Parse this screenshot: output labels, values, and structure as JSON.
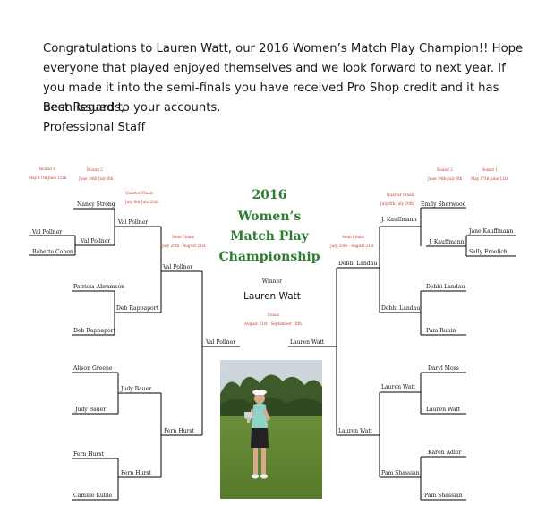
{
  "intro": {
    "paragraph": "Congratulations to Lauren Watt, our 2016 Women’s Match Play Champion!! Hope everyone that played enjoyed themselves and we look forward to next year. If you made it into the semi-finals you have received Pro Shop credit and it has been issued to your accounts.",
    "closing": "Best Regards,",
    "signature": "Professional Staff"
  },
  "bracket": {
    "title_lines": [
      "2016",
      "Women’s",
      "Match Play",
      "Championship"
    ],
    "winner_label": "Winner",
    "winner_name": "Lauren Watt",
    "finals_label": "Finals",
    "finals_dates": "August 21st - September 18th",
    "rounds": {
      "round1_left": {
        "label": "Round 1",
        "dates": "May 17th-June 12th"
      },
      "round2_left": {
        "label": "Round 2",
        "dates": "June 14th-July 6th"
      },
      "quarter_left": {
        "label": "Quarter Finals",
        "dates": "July 6th-July 20th"
      },
      "semi_left": {
        "label": "Semi Finals",
        "dates": "July 20th - August 21st"
      },
      "round1_right": {
        "label": "Round 1",
        "dates": "May 17th-June 12th"
      },
      "round2_right": {
        "label": "Round 2",
        "dates": "June 14th-July 6th"
      },
      "quarter_right": {
        "label": "Quarter Finals",
        "dates": "July 6th-July 20th"
      },
      "semi_right": {
        "label": "Semi Finals",
        "dates": "July 20th - August 21st"
      }
    },
    "left": {
      "r1": [
        "Val Pollner",
        "Babette Cohen"
      ],
      "r2": [
        "Nancy Strong",
        "Val Pollner"
      ],
      "qf_top": "Val Pollner",
      "second_group": [
        "Patricia Abramson",
        "Deb Rappaport"
      ],
      "qf_second": "Deb Rappaport",
      "sf_top": "Val Pollner",
      "third_group": [
        "Alison Greene",
        "Judy Bauer"
      ],
      "qf_third": "Judy Bauer",
      "fourth_group": [
        "Fern Hurst",
        "Camille Kubie"
      ],
      "qf_fourth": "Fern Hurst",
      "sf_bottom": "Fern Hurst",
      "final": "Val Pollner"
    },
    "right": {
      "r1": [
        "Jane Kauffmann",
        "Sally Froelich"
      ],
      "r2": [
        "Emily Sherwood",
        "J. Kauffmann"
      ],
      "qf_top": "J. Kauffmann",
      "second_group": [
        "Debbi Landau",
        "Pam Rubin"
      ],
      "qf_second": "Debbi Landau",
      "sf_top": "Debbi Landau",
      "third_group": [
        "Daryl Moss",
        "Lauren Watt"
      ],
      "qf_third": "Lauren Watt",
      "fourth_group": [
        "Karen Adler",
        "Pam Shassian"
      ],
      "qf_fourth": "Pam Shassian",
      "sf_bottom": "Lauren Watt",
      "final": "Lauren Watt"
    },
    "photo": {
      "icon": "champion-photo"
    }
  }
}
